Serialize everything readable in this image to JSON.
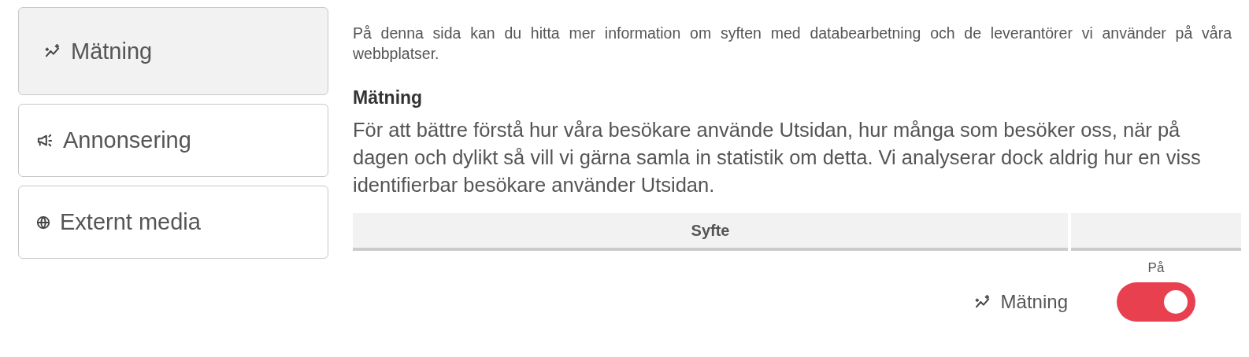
{
  "sidebar": {
    "items": [
      {
        "label": "Mätning",
        "kind": "chart",
        "selected": true
      },
      {
        "label": "Annonsering",
        "kind": "megaphone",
        "selected": false
      },
      {
        "label": "Externt media",
        "kind": "globe",
        "selected": false
      }
    ]
  },
  "intro": "På denna sida kan du hitta mer information om syften med databearbetning och de leverantörer vi använder på våra webbplatser.",
  "section": {
    "heading": "Mätning",
    "text": "För att bättre förstå hur våra besökare använde Utsidan, hur många som besöker oss, när på dagen och dylikt så vill vi gärna samla in statistik om detta. Vi analyserar dock aldrig hur en viss identifierbar besökare använder Utsidan."
  },
  "table": {
    "columns": [
      "Syfte"
    ],
    "rows": [
      {
        "purpose": "Mätning",
        "kind": "chart",
        "toggle_label": "På",
        "on": true
      }
    ]
  }
}
